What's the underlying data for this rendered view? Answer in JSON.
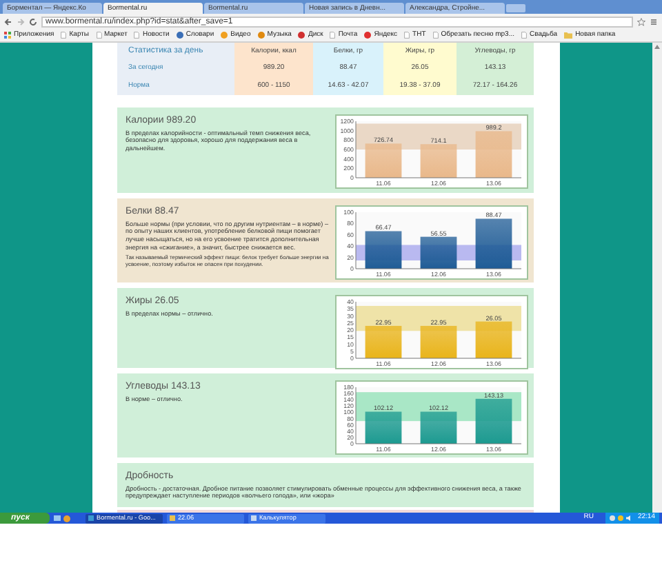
{
  "browser": {
    "tabs": [
      {
        "label": "Борментал — Яндекс.Ко",
        "selected": false
      },
      {
        "label": "Bormental.ru",
        "selected": true
      },
      {
        "label": "Bormental.ru",
        "selected": false
      },
      {
        "label": "Новая запись в Дневн...",
        "selected": false
      },
      {
        "label": "Александра, Стройне...",
        "selected": false
      }
    ],
    "address": "www.bormental.ru/index.php?id=stat&after_save=1",
    "bookmarks": [
      {
        "label": "Приложения",
        "kind": "apps"
      },
      {
        "label": "Карты",
        "kind": "page"
      },
      {
        "label": "Маркет",
        "kind": "page"
      },
      {
        "label": "Новости",
        "kind": "page"
      },
      {
        "label": "Словари",
        "kind": "service",
        "color": "#3b6fb6"
      },
      {
        "label": "Видео",
        "kind": "service",
        "color": "#f0a020"
      },
      {
        "label": "Музыка",
        "kind": "service",
        "color": "#e08a10"
      },
      {
        "label": "Диск",
        "kind": "service",
        "color": "#d03030"
      },
      {
        "label": "Почта",
        "kind": "page"
      },
      {
        "label": "Яндекс",
        "kind": "service",
        "color": "#e03030"
      },
      {
        "label": "ТНТ",
        "kind": "page"
      },
      {
        "label": "Обрезать песню mp3...",
        "kind": "page"
      },
      {
        "label": "Свадьба",
        "kind": "page"
      },
      {
        "label": "Новая папка",
        "kind": "folder"
      }
    ]
  },
  "stats_table": {
    "columns": [
      "Статистика за день",
      "Калории, ккал",
      "Белки, гр",
      "Жиры, гр",
      "Углеводы, гр"
    ],
    "rows": [
      [
        "За сегодня",
        "989.20",
        "88.47",
        "26.05",
        "143.13"
      ],
      [
        "Норма",
        "600 - 1150",
        "14.63 - 42.07",
        "19.38 - 37.09",
        "72.17 - 164.26"
      ]
    ]
  },
  "sections": [
    {
      "title": "Калории 989.20",
      "above_norm": false,
      "text": [
        "В пределах калорийности - оптимальный темп снижения веса, безопасно для здоровья, хорошо для поддержания веса в дальнейшем."
      ],
      "chart_data": {
        "type": "bar",
        "categories": [
          "11.06",
          "12.06",
          "13.06"
        ],
        "series": [
          {
            "color": "#e9b88a",
            "values": [
              726.74,
              714.1,
              989.2
            ]
          }
        ],
        "ylim": [
          0,
          1200
        ],
        "yticks": [
          0,
          200,
          400,
          600,
          800,
          1000,
          1200
        ],
        "data_labels": true,
        "bands": [
          {
            "axis": "y",
            "from": 600,
            "to": 1150,
            "color": "#ead8c6"
          }
        ]
      }
    },
    {
      "title": "Белки 88.47",
      "above_norm": true,
      "text": [
        "Больше нормы (при условии, что по другим нутриентам – в норме) – по опыту наших клиентов, употребление белковой пищи помогает лучше насыщаться, но на его усвоение тратится дополнительная энергия на «сжигание», а значит, быстрее снижается вес.",
        "Так называемый термический эффект пищи: белок требует больше энергии на усвоение, поэтому избыток не опасен при похудении."
      ],
      "chart_data": {
        "type": "bar",
        "categories": [
          "11.06",
          "12.06",
          "13.06"
        ],
        "series": [
          {
            "color": "#1f5c96",
            "values": [
              66.47,
              56.55,
              88.47
            ]
          }
        ],
        "ylim": [
          0,
          100
        ],
        "yticks": [
          0,
          20,
          40,
          60,
          80,
          100
        ],
        "data_labels": true,
        "bands": [
          {
            "axis": "y",
            "from": 14.63,
            "to": 42.07,
            "color": "#b9b9f0"
          }
        ]
      }
    },
    {
      "title": "Жиры 26.05",
      "above_norm": false,
      "text": [
        "В пределах нормы – отлично."
      ],
      "chart_data": {
        "type": "bar",
        "categories": [
          "11.06",
          "12.06",
          "13.06"
        ],
        "series": [
          {
            "color": "#e9b41a",
            "values": [
              22.95,
              22.95,
              26.05
            ]
          }
        ],
        "ylim": [
          0,
          40
        ],
        "yticks": [
          0,
          5,
          10,
          15,
          20,
          25,
          30,
          35,
          40
        ],
        "data_labels": true,
        "bands": [
          {
            "axis": "y",
            "from": 19.38,
            "to": 37.09,
            "color": "#efe3a8"
          }
        ]
      }
    },
    {
      "title": "Углеводы 143.13",
      "above_norm": false,
      "text": [
        "В норме – отлично."
      ],
      "chart_data": {
        "type": "bar",
        "categories": [
          "11.06",
          "12.06",
          "13.06"
        ],
        "series": [
          {
            "color": "#1c9a90",
            "values": [
              102.12,
              102.12,
              143.13
            ]
          }
        ],
        "ylim": [
          0,
          180
        ],
        "yticks": [
          0,
          20,
          40,
          60,
          80,
          100,
          120,
          140,
          160,
          180
        ],
        "data_labels": true,
        "bands": [
          {
            "axis": "y",
            "from": 72.17,
            "to": 164.26,
            "color": "#a9e7c6"
          }
        ]
      }
    },
    {
      "title": "Дробность",
      "above_norm": false,
      "text": [
        "Дробность - достаточная. Дробное питание позволяет стимулировать обменные процессы для эффективного снижения веса, а также предупреждает наступление периодов «волчьего голода», или «жора»"
      ]
    }
  ],
  "taskbar": {
    "start": "пуск",
    "tasks": [
      {
        "label": "Bormental.ru - Goo...",
        "kind": "browser",
        "selected": true
      },
      {
        "label": "22.06",
        "kind": "folder",
        "selected": false
      },
      {
        "label": "Калькулятор",
        "kind": "app",
        "selected": false
      }
    ],
    "language": "RU",
    "clock": "22:14"
  }
}
